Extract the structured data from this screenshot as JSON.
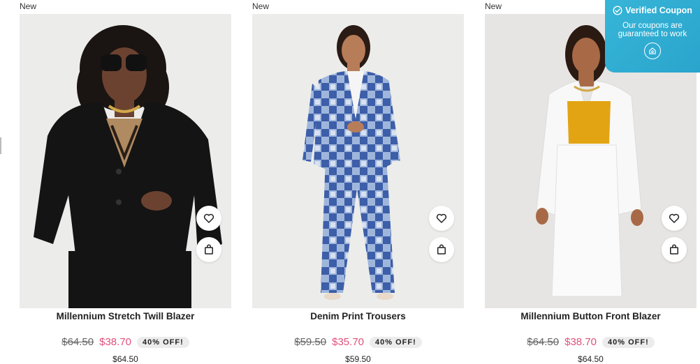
{
  "products": [
    {
      "badge": "New",
      "name": "Millennium Stretch Twill Blazer",
      "old_price": "$64.50",
      "sale_price": "$38.70",
      "discount": "40% OFF!",
      "price": "$64.50",
      "wish_icon": "heart-icon",
      "cart_icon": "shopping-bag-icon"
    },
    {
      "badge": "New",
      "name": "Denim Print Trousers",
      "old_price": "$59.50",
      "sale_price": "$35.70",
      "discount": "40% OFF!",
      "price": "$59.50",
      "wish_icon": "heart-icon",
      "cart_icon": "shopping-bag-icon"
    },
    {
      "badge": "New",
      "name": "Millennium Button Front Blazer",
      "old_price": "$64.50",
      "sale_price": "$38.70",
      "discount": "40% OFF!",
      "price": "$64.50",
      "wish_icon": "heart-icon",
      "cart_icon": "shopping-bag-icon"
    }
  ],
  "coupon": {
    "title": "Verified Coupon",
    "subtitle": "Our coupons are guaranteed to work",
    "icon": "check-circle-icon",
    "logo_icon": "shop-logo-icon"
  },
  "colors": {
    "sale": "#e0507a",
    "coupon_bg": "#2aa4cc",
    "badge_bg": "#ececec"
  }
}
